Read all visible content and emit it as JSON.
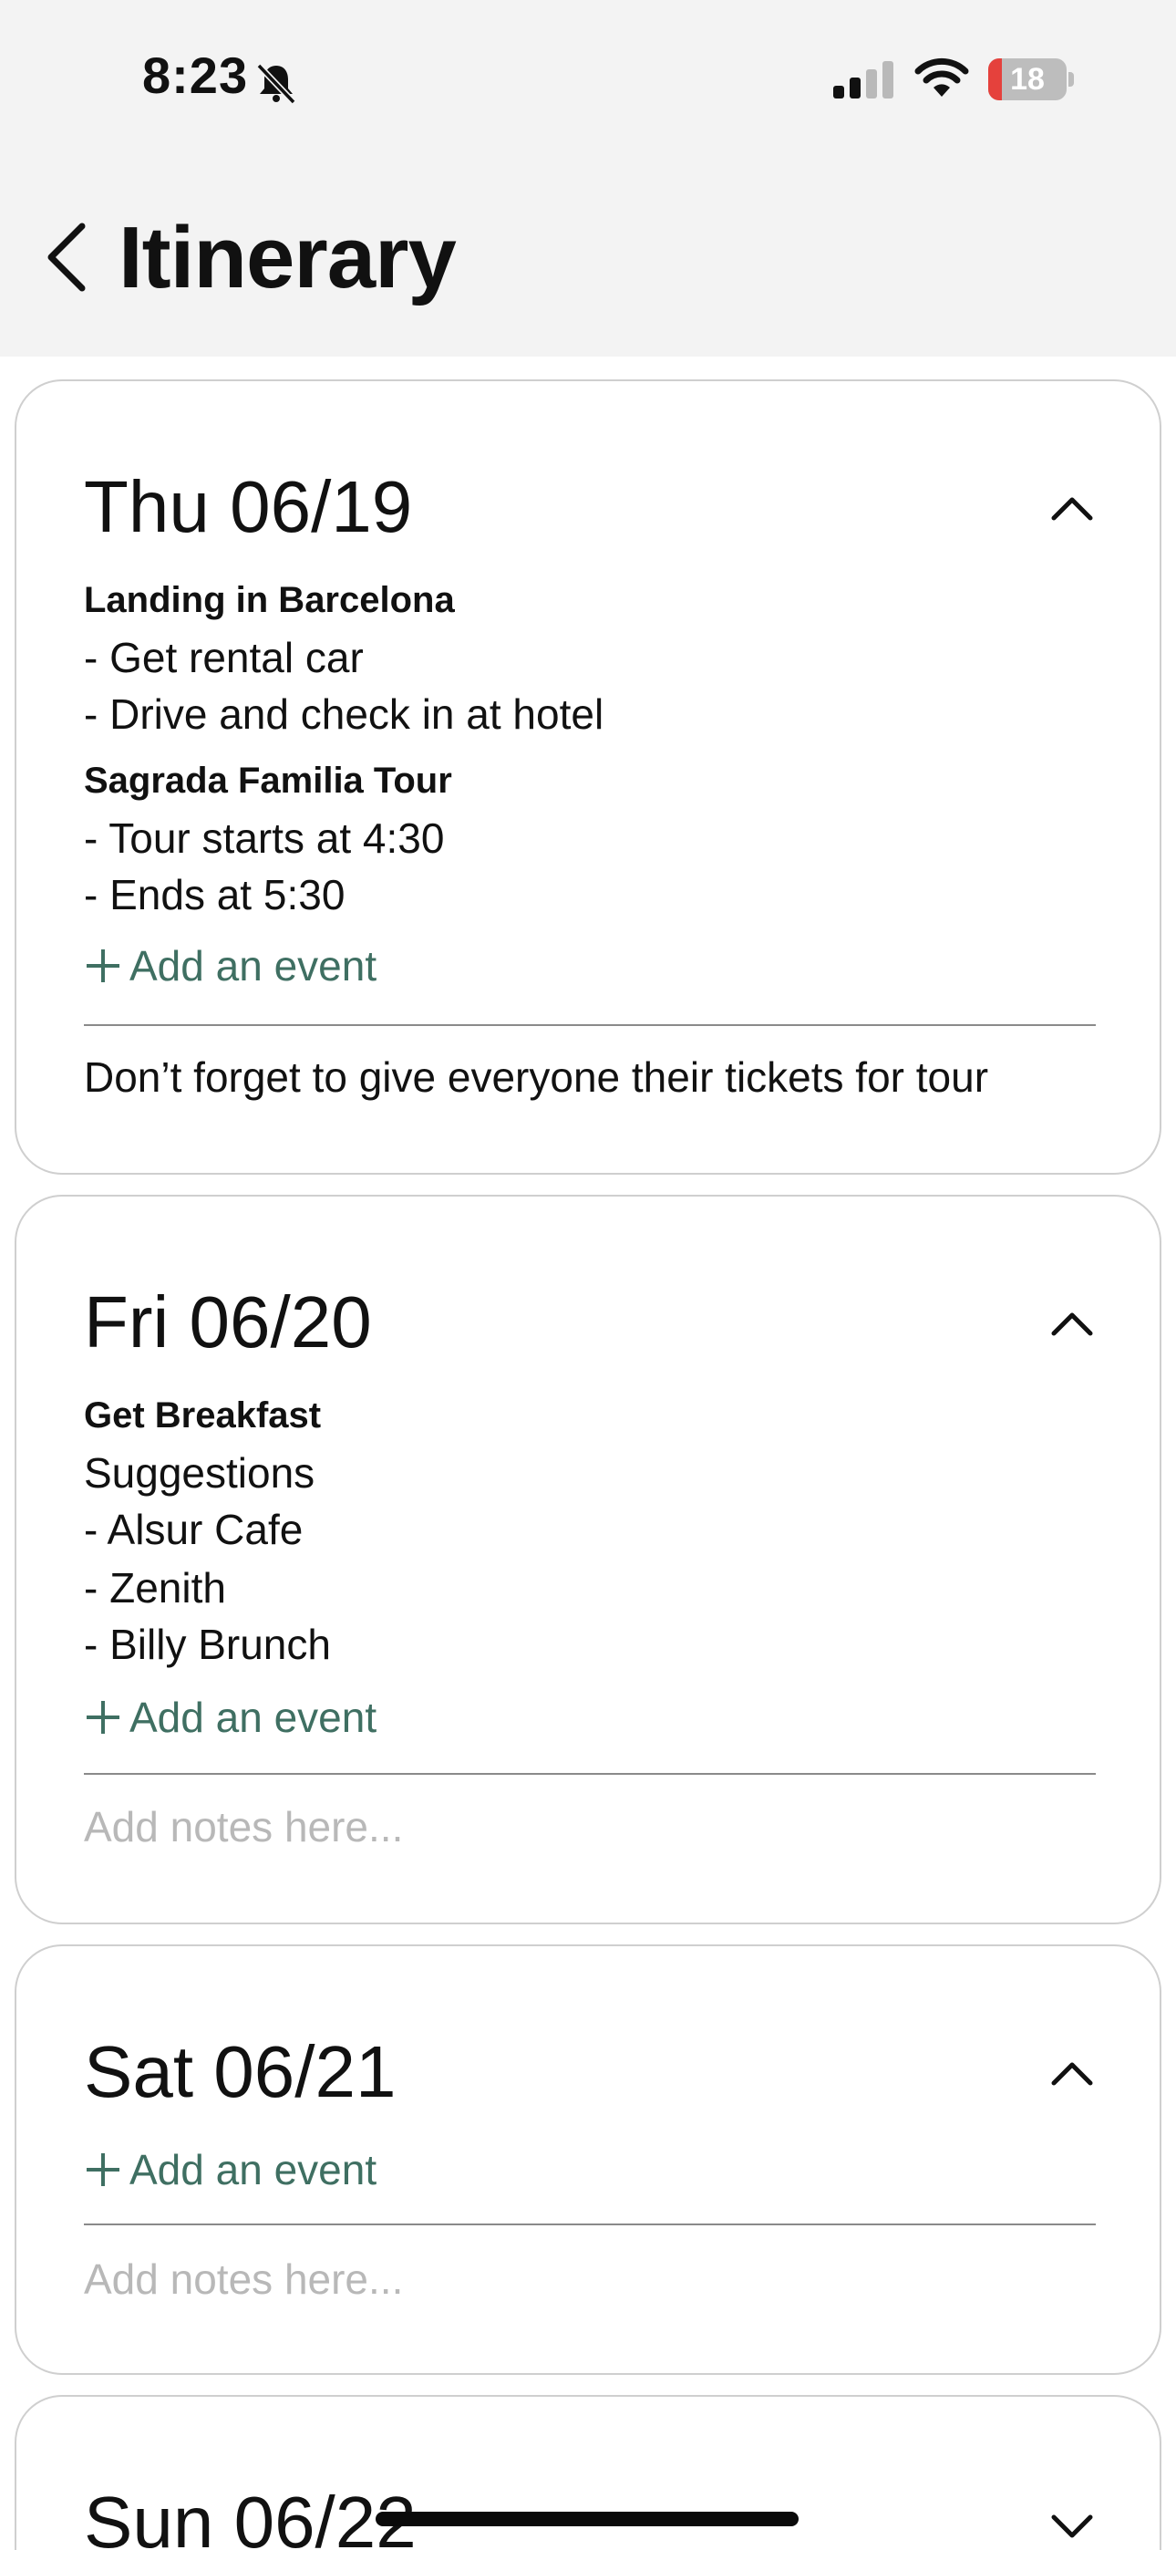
{
  "status_bar": {
    "time": "8:23",
    "battery_level": "18",
    "battery_fraction": 0.18,
    "icons": [
      "bell-slash-icon",
      "cellular-signal-icon",
      "wifi-icon",
      "battery-icon"
    ]
  },
  "header": {
    "back_icon": "chevron-left-icon",
    "title": "Itinerary"
  },
  "colors": {
    "accent": "#3f6f62",
    "battery_low": "#e5413c",
    "header_bg": "#f3f3f3"
  },
  "days": [
    {
      "title": "Thu 06/19",
      "expanded": true,
      "events": [
        {
          "title": "Landing in Barcelona",
          "lines": [
            "- Get rental car",
            "- Drive and check in at hotel"
          ]
        },
        {
          "title": "Sagrada Familia Tour",
          "lines": [
            "- Tour starts at 4:30",
            "- Ends at 5:30"
          ]
        }
      ],
      "add_event_label": "Add an event",
      "notes": "Don’t forget to give everyone their tickets for tour"
    },
    {
      "title": "Fri 06/20",
      "expanded": true,
      "events": [
        {
          "title": "Get Breakfast",
          "lines": [
            "Suggestions",
            "- Alsur Cafe",
            "- Zenith",
            "- Billy Brunch"
          ]
        }
      ],
      "add_event_label": "Add an event",
      "notes_placeholder": "Add notes here..."
    },
    {
      "title": "Sat 06/21",
      "expanded": true,
      "events": [],
      "add_event_label": "Add an event",
      "notes_placeholder": "Add notes here..."
    },
    {
      "title": "Sun 06/22",
      "expanded": false
    }
  ]
}
